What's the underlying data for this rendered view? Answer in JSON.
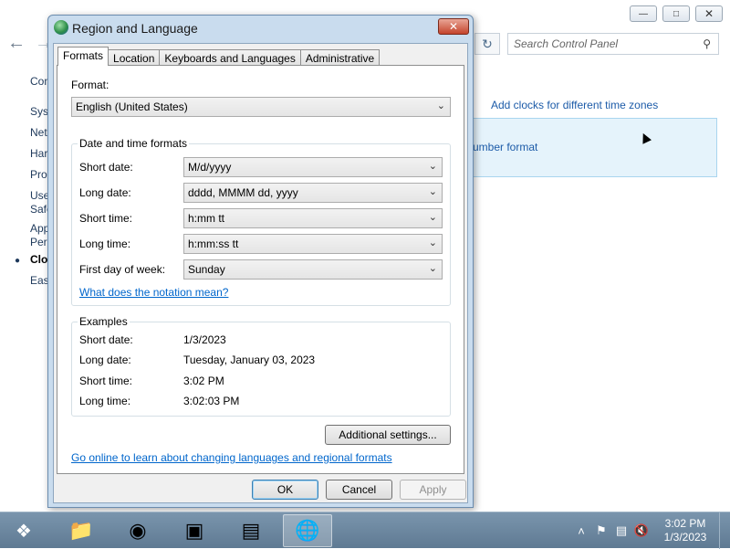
{
  "control_panel": {
    "nav_items": [
      "Con",
      "Syst",
      "Net",
      "Har",
      "Prog",
      "Use",
      "Safe",
      "App",
      "Pers",
      "Cloc",
      "Eas"
    ],
    "active_item": "Cloc",
    "search_placeholder": "Search Control Panel",
    "link_add_clocks": "Add clocks for different time zones",
    "link_number_format": "umber format"
  },
  "dialog": {
    "title": "Region and Language",
    "tabs": [
      "Formats",
      "Location",
      "Keyboards and Languages",
      "Administrative"
    ],
    "active_tab": "Formats",
    "format_label": "Format:",
    "format_value": "English (United States)",
    "date_time_group_title": "Date and time formats",
    "rows": [
      {
        "label": "Short date:",
        "value": "M/d/yyyy"
      },
      {
        "label": "Long date:",
        "value": "dddd, MMMM dd, yyyy"
      },
      {
        "label": "Short time:",
        "value": "h:mm tt"
      },
      {
        "label": "Long time:",
        "value": "h:mm:ss tt"
      },
      {
        "label": "First day of week:",
        "value": "Sunday"
      }
    ],
    "notation_link": "What does the notation mean?",
    "examples_title": "Examples",
    "examples": [
      {
        "label": "Short date:",
        "value": "1/3/2023"
      },
      {
        "label": "Long date:",
        "value": "Tuesday, January 03, 2023"
      },
      {
        "label": "Short time:",
        "value": "3:02 PM"
      },
      {
        "label": "Long time:",
        "value": "3:02:03 PM"
      }
    ],
    "additional_settings": "Additional settings...",
    "online_link": "Go online to learn about changing languages and regional formats",
    "ok": "OK",
    "cancel": "Cancel",
    "apply": "Apply"
  },
  "taskbar": {
    "time": "3:02 PM",
    "date": "1/3/2023",
    "apps": [
      "file-explorer-icon",
      "firefox-icon",
      "sticky-notes-icon",
      "control-panel-icon",
      "region-language-icon"
    ]
  }
}
